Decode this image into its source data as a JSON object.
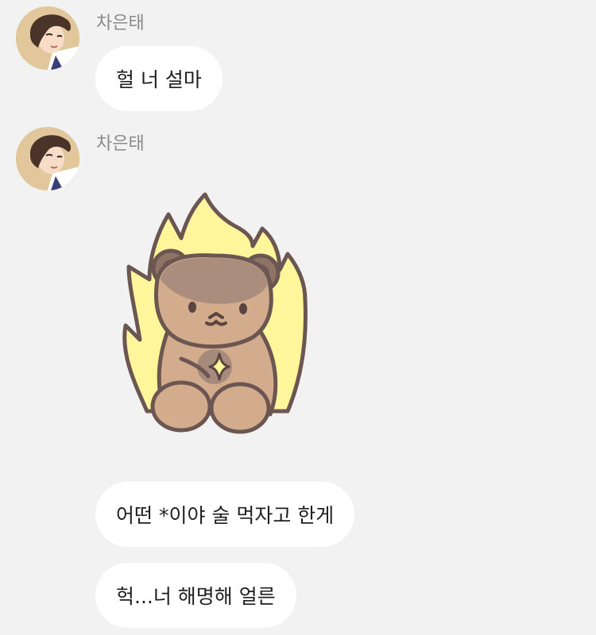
{
  "chat": {
    "messages": [
      {
        "sender": "차은태",
        "text": "헐 너 설마"
      },
      {
        "sender": "차은태",
        "sticker": "flaming-bear-sticker"
      },
      {
        "text": "어떤 *이야 술 먹자고 한게"
      },
      {
        "text": "헉...너 해명해 얼른"
      }
    ]
  },
  "colors": {
    "background": "#f2f2f2",
    "bubble": "#ffffff",
    "sender_name": "#8a8a8a",
    "message_text": "#1f1f1f",
    "sticker_flame": "#fff59a",
    "sticker_bear": "#d2ac8c",
    "sticker_outline": "#6b5652"
  }
}
